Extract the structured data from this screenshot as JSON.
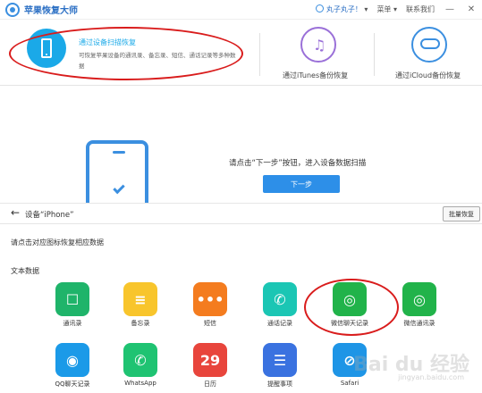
{
  "titlebar": {
    "app_title": "苹果恢复大师",
    "user": "丸子丸子！",
    "menu": "菜单",
    "contact": "联系我们",
    "minimize": "—",
    "close": "✕"
  },
  "modes": {
    "device": {
      "title": "通过设备扫描恢复",
      "desc": "可恢复苹果设备的通讯录、备忘录、短信、通话记录等多种数据"
    },
    "itunes_label": "通过iTunes备份恢复",
    "icloud_label": "通过iCloud备份恢复"
  },
  "hero": {
    "instruction": "请点击“下一步”按钮，进入设备数据扫描",
    "next_label": "下一步"
  },
  "device_bar": {
    "back": "←",
    "device_label": "设备“iPhone”",
    "batch_label": "批量恢复"
  },
  "hint": "请点击对应图标恢复相应数据",
  "section_title": "文本数据",
  "apps": [
    {
      "label": "通讯录",
      "color": "#1fb46a",
      "glyph": "☐"
    },
    {
      "label": "备忘录",
      "color": "#f8c52c",
      "glyph": "≡"
    },
    {
      "label": "短信",
      "color": "#f47c1f",
      "glyph": "•••"
    },
    {
      "label": "通话记录",
      "color": "#1bc6b4",
      "glyph": "✆"
    },
    {
      "label": "微信聊天记录",
      "color": "#21b34a",
      "glyph": "◎"
    },
    {
      "label": "微信通讯录",
      "color": "#21b34a",
      "glyph": "◎"
    },
    {
      "label": "QQ聊天记录",
      "color": "#1b9ae8",
      "glyph": "◉"
    },
    {
      "label": "WhatsApp",
      "color": "#1fc372",
      "glyph": "✆"
    },
    {
      "label": "日历",
      "color": "#e8453c",
      "glyph": "29"
    },
    {
      "label": "提醒事项",
      "color": "#3a72e0",
      "glyph": "☰"
    },
    {
      "label": "Safari",
      "color": "#1e95e6",
      "glyph": "⊘"
    }
  ],
  "watermark": "Bai du 经验",
  "watermark_sub": "jingyan.baidu.com"
}
